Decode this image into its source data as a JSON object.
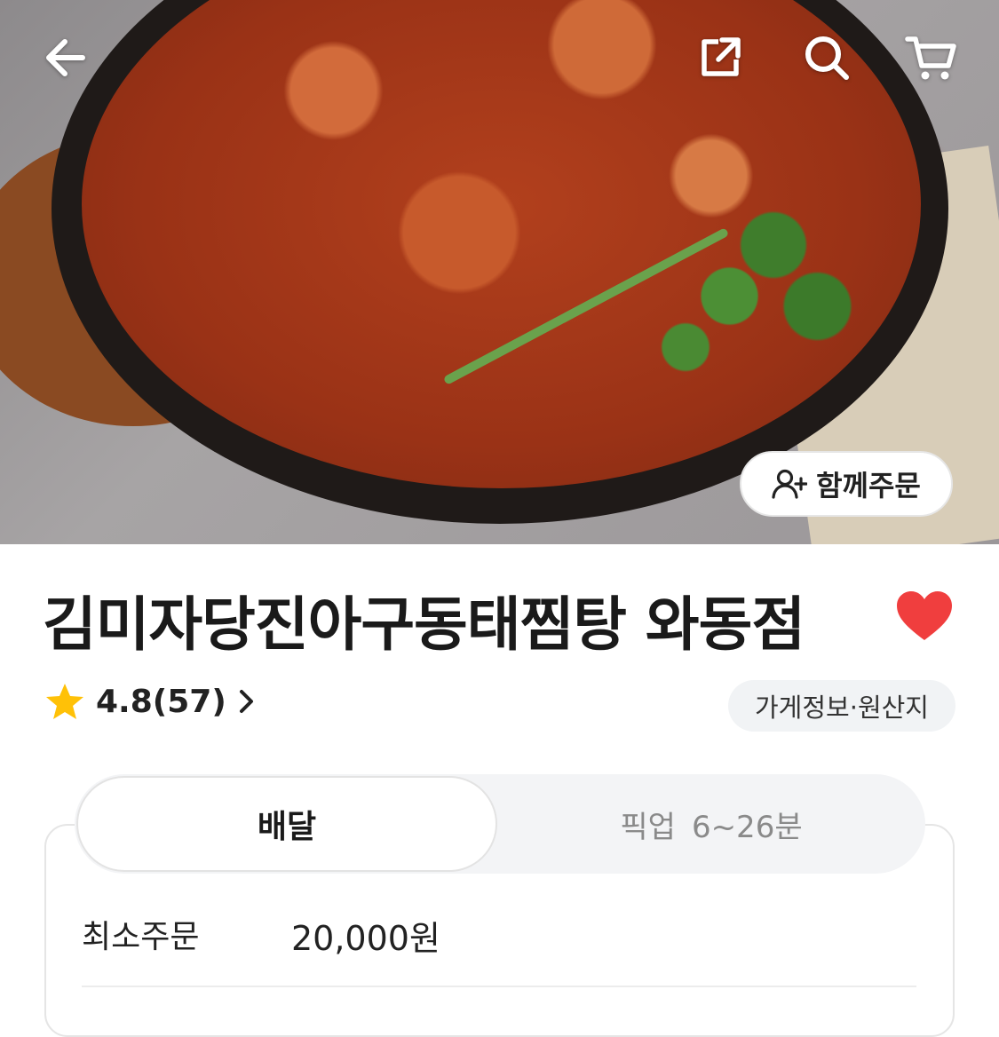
{
  "hero": {
    "group_order_label": "함께주문"
  },
  "store": {
    "name": "김미자당진아구동태찜탕 와동점",
    "rating": "4.8",
    "review_count": "(57)",
    "info_label": "가게정보·원산지"
  },
  "order_tabs": {
    "delivery_label": "배달",
    "pickup_label": "픽업",
    "pickup_time": "6~26분"
  },
  "delivery_info": {
    "min_order_label": "최소주문",
    "min_order_value": "20,000원"
  },
  "colors": {
    "heart": "#f03e3e",
    "star": "#ffc107"
  }
}
